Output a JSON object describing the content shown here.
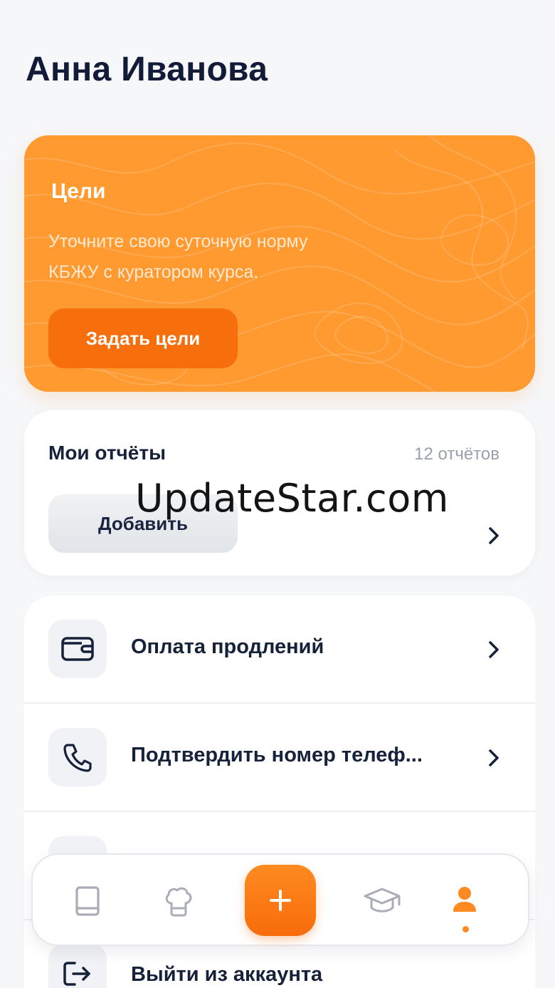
{
  "profile": {
    "name": "Анна Иванова"
  },
  "goals": {
    "title": "Цели",
    "text": "Уточните свою суточную норму КБЖУ с куратором курса.",
    "button_label": "Задать цели"
  },
  "reports": {
    "title": "Мои отчёты",
    "count": "12 отчётов",
    "add_label": "Добавить"
  },
  "menu": {
    "items": [
      {
        "label": "Оплата продлений",
        "icon": "wallet-icon"
      },
      {
        "label": "Подтвердить номер телеф...",
        "icon": "phone-icon"
      },
      {
        "label": "",
        "icon": "hidden-icon"
      },
      {
        "label": "Выйти из аккаунта",
        "icon": "logout-icon"
      }
    ]
  },
  "tabbar": {
    "tabs": [
      {
        "icon": "book-icon",
        "active": false
      },
      {
        "icon": "chef-hat-icon",
        "active": false
      },
      {
        "icon": "plus-icon",
        "active": false
      },
      {
        "icon": "graduation-cap-icon",
        "active": false
      },
      {
        "icon": "profile-icon",
        "active": true
      }
    ]
  },
  "watermark": "UpdateStar.com",
  "colors": {
    "accent": "#ff9a30",
    "accent_dark": "#f76e0d",
    "text": "#16213a",
    "muted": "#9aa1ac",
    "background": "#f6f7f9"
  }
}
